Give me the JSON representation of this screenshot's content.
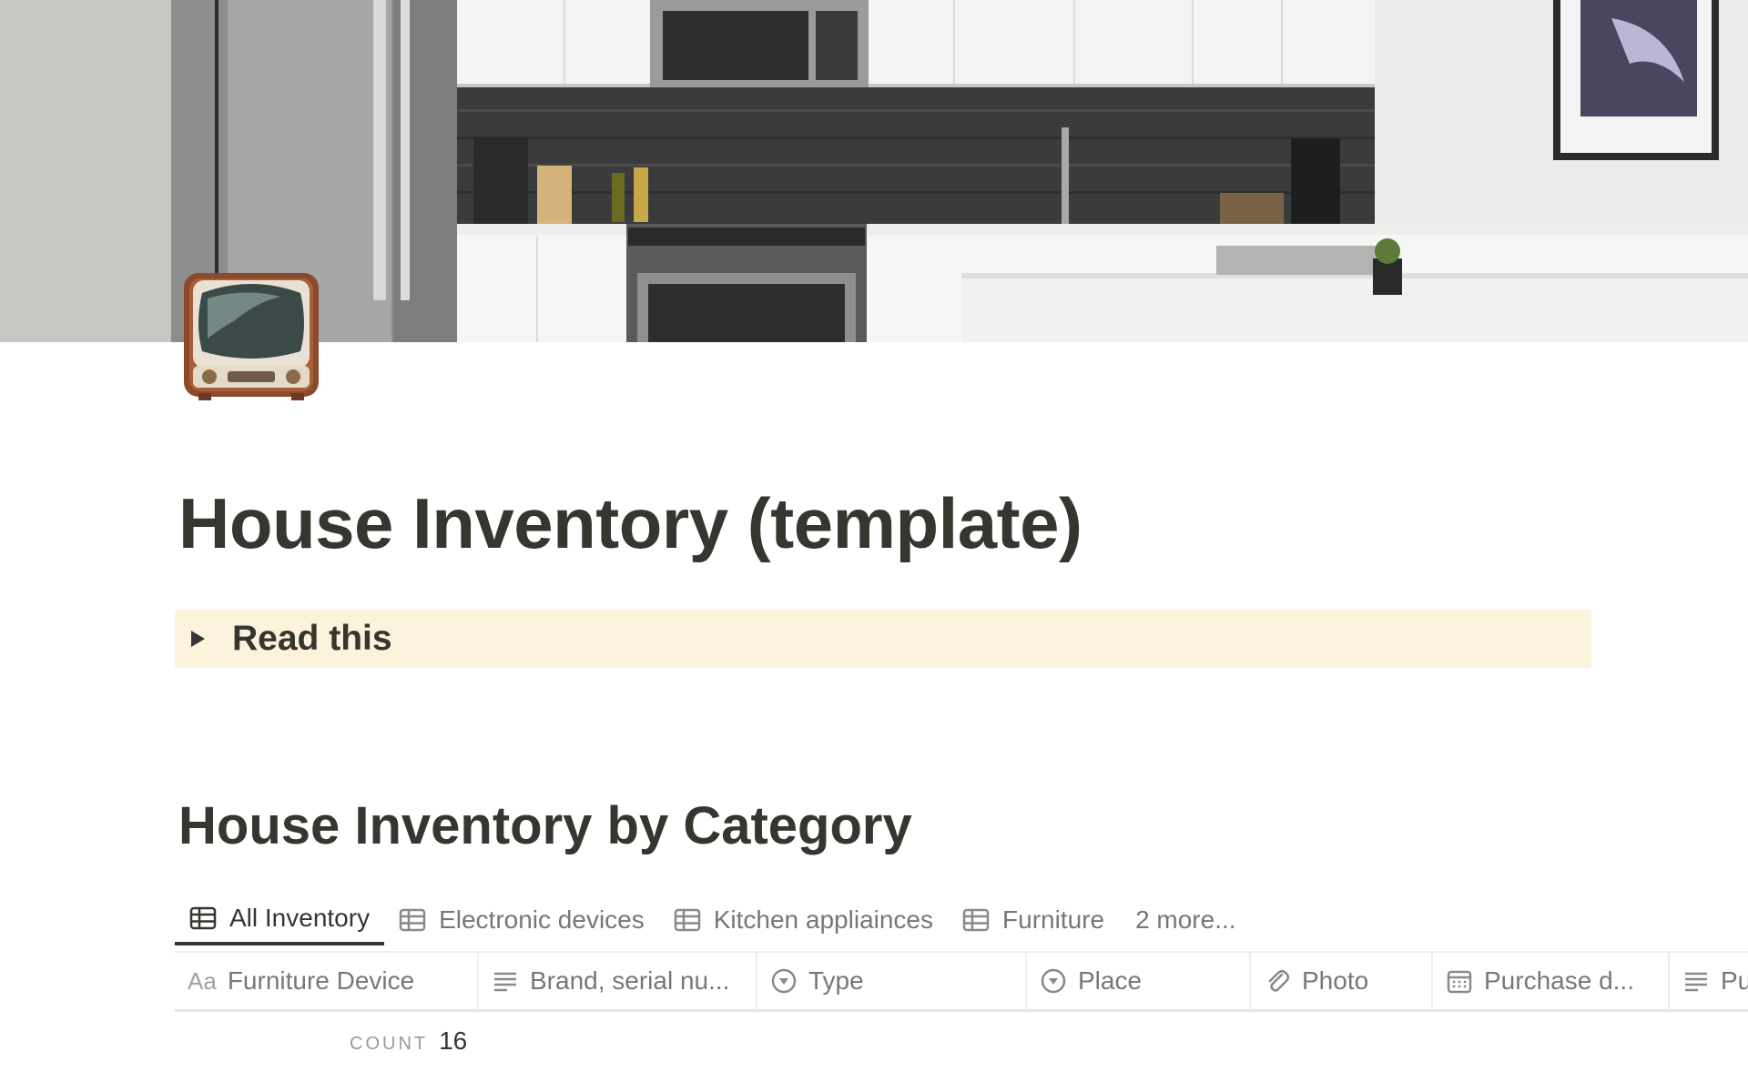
{
  "page": {
    "title": "House Inventory (template)",
    "icon": "television-icon"
  },
  "callout": {
    "label": "Read this",
    "background": "#fbf3db"
  },
  "database": {
    "title": "House Inventory by Category",
    "views": [
      {
        "label": "All Inventory",
        "icon": "table-icon",
        "active": true
      },
      {
        "label": "Electronic devices",
        "icon": "table-icon"
      },
      {
        "label": "Kitchen appliainces",
        "icon": "table-icon"
      },
      {
        "label": "Furniture",
        "icon": "table-icon"
      },
      {
        "label": "2 more..."
      }
    ],
    "columns": [
      {
        "label": "Furniture Device",
        "icon": "title-aa-icon",
        "icon_text": "Aa"
      },
      {
        "label": "Brand, serial nu...",
        "icon": "text-lines-icon"
      },
      {
        "label": "Type",
        "icon": "select-icon"
      },
      {
        "label": "Place",
        "icon": "select-icon"
      },
      {
        "label": "Photo",
        "icon": "paperclip-icon"
      },
      {
        "label": "Purchase d...",
        "icon": "calendar-icon"
      },
      {
        "label": "Pu",
        "icon": "text-lines-icon"
      }
    ],
    "count_label": "COUNT",
    "count_value": "16"
  }
}
